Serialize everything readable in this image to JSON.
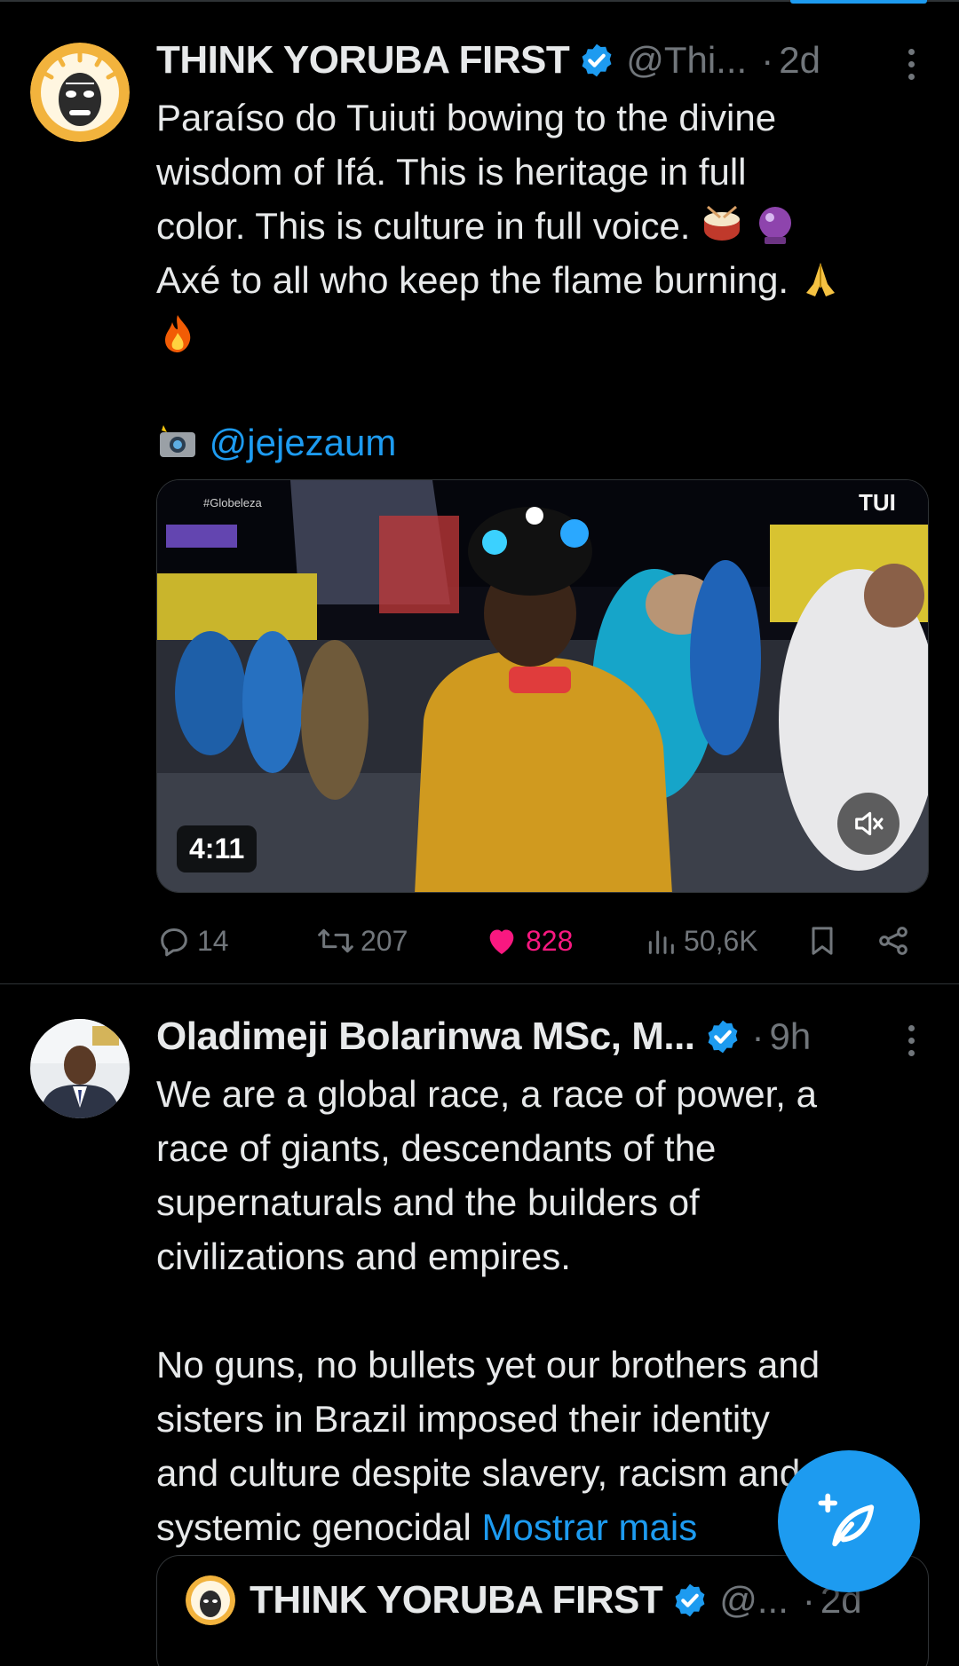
{
  "feed": {
    "tweet1": {
      "author_name": "THINK YORUBA FIRST",
      "handle": "@Thi...",
      "separator": "·",
      "time": "2d",
      "text_lines": [
        "Paraíso do Tuiuti bowing to the divine",
        "wisdom of Ifá. This is heritage in full",
        "color. This is culture in full voice.",
        "Axé to all who keep the flame burning."
      ],
      "credit_handle": "@jejezaum",
      "video": {
        "duration": "4:11",
        "overlay_watermark": "#Globeleza",
        "overlay_sign": "TUI"
      },
      "actions": {
        "replies": "14",
        "reposts": "207",
        "likes": "828",
        "views": "50,6K"
      },
      "colors": {
        "like_active": "#f91880"
      }
    },
    "tweet2": {
      "author_name": "Oladimeji Bolarinwa MSc, M...",
      "separator": "·",
      "time": "9h",
      "para1_lines": [
        "We are a global race, a race of power, a",
        "race of giants, descendants of the",
        "supernaturals and the builders of",
        "civilizations and empires."
      ],
      "para2_lines": [
        "No guns, no bullets yet our brothers and",
        "sisters in Brazil imposed their identity",
        "and culture despite slavery, racism and",
        "systemic genocidal"
      ],
      "show_more": "Mostrar mais",
      "quote": {
        "author_name": "THINK YORUBA FIRST",
        "handle": "@...",
        "separator": "·",
        "time": "2d"
      }
    }
  },
  "icons": {
    "verified": "verified-badge-icon",
    "reply": "reply-icon",
    "repost": "repost-icon",
    "like": "heart-icon",
    "views": "views-icon",
    "bookmark": "bookmark-icon",
    "share": "share-icon",
    "compose": "compose-post-icon",
    "mute": "mute-icon",
    "more": "more-icon"
  },
  "colors": {
    "background": "#000000",
    "text": "#e7e9ea",
    "muted": "#71767b",
    "accent": "#1d9bf0",
    "divider": "#2f3336"
  }
}
